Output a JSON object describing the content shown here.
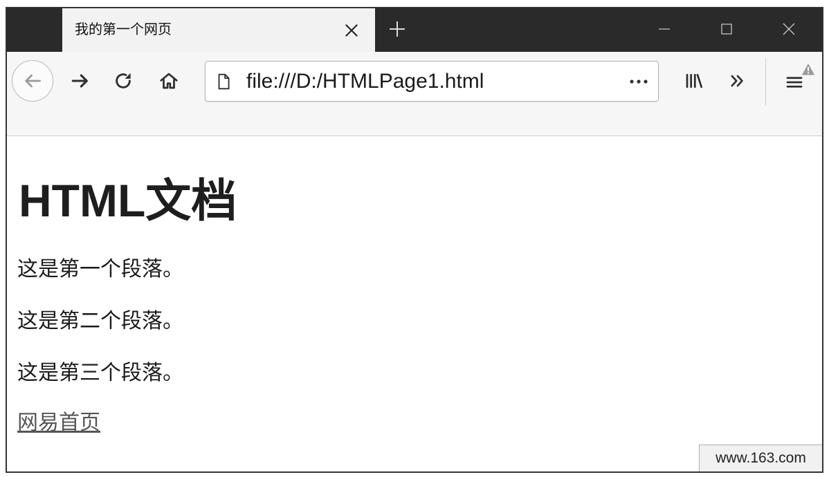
{
  "browser": {
    "tab": {
      "title": "我的第一个网页",
      "close_icon": "close-icon"
    },
    "new_tab_icon": "plus-icon",
    "window_controls": {
      "minimize_icon": "minimize-icon",
      "maximize_icon": "maximize-icon",
      "close_icon": "window-close-icon"
    },
    "toolbar": {
      "back_icon": "back-arrow-icon",
      "forward_icon": "forward-arrow-icon",
      "reload_icon": "reload-icon",
      "home_icon": "home-icon",
      "address_bar": {
        "page_icon": "page-icon",
        "url": "file:///D:/HTMLPage1.html",
        "more_icon": "more-actions-icon"
      },
      "library_icon": "library-icon",
      "overflow_icon": "overflow-chevrons-icon",
      "menu_icon": "hamburger-menu-icon",
      "menu_badge_icon": "warning-icon"
    },
    "status_bar": {
      "text": "www.163.com"
    }
  },
  "page": {
    "heading": "HTML文档",
    "paragraphs": [
      "这是第一个段落。",
      "这是第二个段落。",
      "这是第三个段落。"
    ],
    "link": {
      "text": "网易首页"
    }
  },
  "colors": {
    "titlebar_bg": "#2b2a2b",
    "tab_bg": "#f2f2f2",
    "toolbar_bg": "#f6f6f6",
    "content_bg": "#ffffff",
    "text": "#1a1a1a",
    "link": "#555555",
    "disabled_icon": "#9a9a9a"
  }
}
